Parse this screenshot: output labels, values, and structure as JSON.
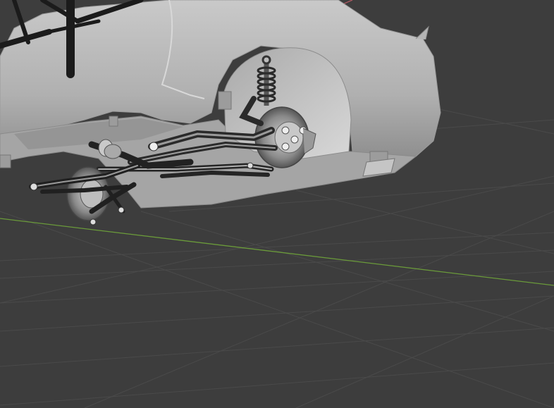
{
  "viewport": {
    "mode": "3d-perspective",
    "background_color": "#3d3d3d",
    "grid_color": "#4a4a4a",
    "x_axis_color": "#b05a63",
    "y_axis_color": "#6a9a3a",
    "grid_visible": true,
    "axes_visible": [
      "x",
      "y"
    ]
  },
  "scene": {
    "objects": [
      {
        "name": "car-body",
        "material": "matte-gray",
        "color": "#b8b8b8"
      },
      {
        "name": "front-suspension",
        "material": "chrome",
        "color": "#2a2a2a",
        "parts": [
          "coil-spring",
          "control-arm",
          "tie-rod",
          "brake-disc",
          "hub",
          "lower-arm"
        ]
      },
      {
        "name": "rear-suspension",
        "material": "chrome",
        "color": "#2a2a2a",
        "parts": [
          "brake-disc",
          "control-arm"
        ]
      },
      {
        "name": "roll-cage-tubes",
        "material": "black-metal",
        "color": "#1a1a1a"
      }
    ]
  }
}
